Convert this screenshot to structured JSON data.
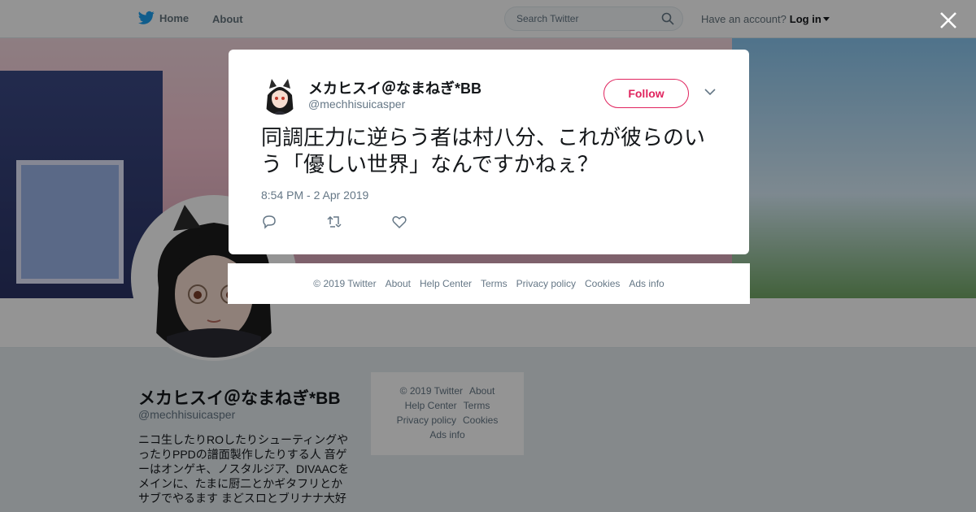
{
  "nav": {
    "home_label": "Home",
    "about_label": "About",
    "search_placeholder": "Search Twitter",
    "account_prompt": "Have an account?",
    "login_label": "Log in",
    "brand_color": "#1da1f2"
  },
  "profile": {
    "name": "メカヒスイ＠なまねぎ*BB",
    "handle": "@mechhisuicasper",
    "bio": "ニコ生したりROしたりシューティングやったりPPDの譜面製作したりする人 音ゲーはオンゲキ、ノスタルジア、DIVAACをメインに、たまに厨二とかギタフリとかサブでやるます まどスロとブリナナ大好"
  },
  "side_footer": {
    "copyright": "© 2019 Twitter",
    "about": "About",
    "help": "Help Center",
    "terms": "Terms",
    "privacy": "Privacy policy",
    "cookies": "Cookies",
    "ads": "Ads info"
  },
  "tweet": {
    "author_name": "メカヒスイ＠なまねぎ*BB",
    "author_handle": "@mechhisuicasper",
    "follow_label": "Follow",
    "text": "同調圧力に逆らう者は村八分、これが彼らのいう「優しい世界」なんですかねぇ？",
    "timestamp": "8:54 PM - 2 Apr 2019",
    "accent_color": "#e0245e"
  },
  "modal_footer": {
    "items": [
      "© 2019 Twitter",
      "About",
      "Help Center",
      "Terms",
      "Privacy policy",
      "Cookies",
      "Ads info"
    ]
  }
}
